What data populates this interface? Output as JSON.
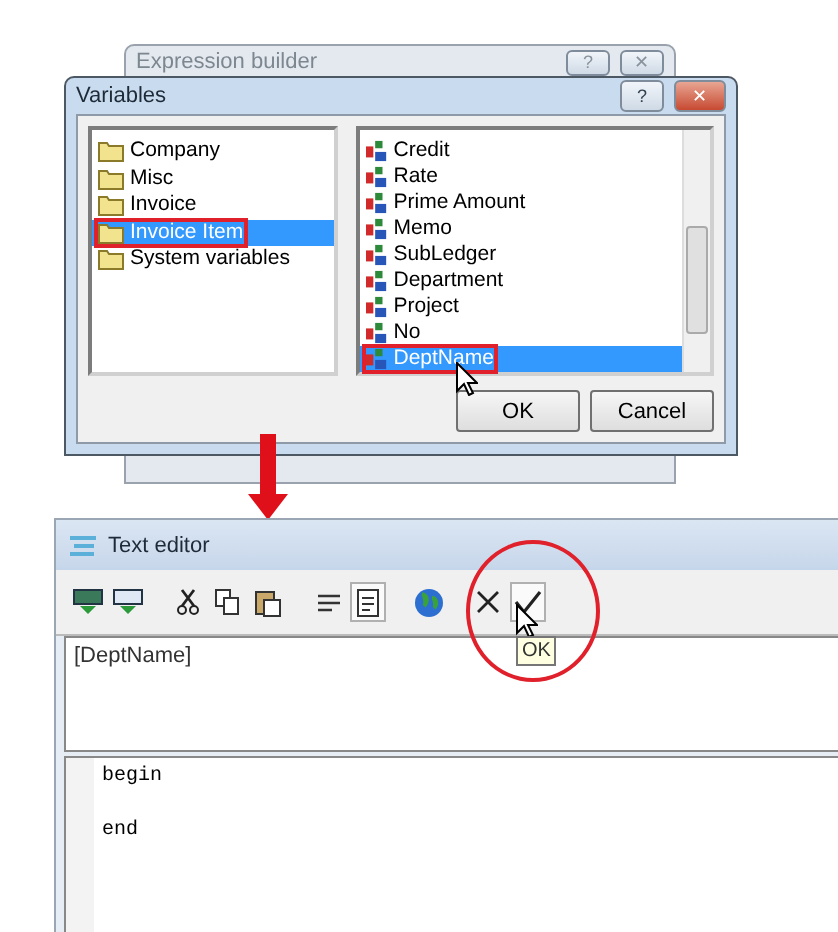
{
  "expression_builder": {
    "title": "Expression builder",
    "title_buttons": [
      "?",
      "✕"
    ]
  },
  "variables_dialog": {
    "title": "Variables",
    "title_buttons": [
      "?",
      "✕"
    ],
    "categories": [
      {
        "label": "Company",
        "selected": false
      },
      {
        "label": "Misc",
        "selected": false
      },
      {
        "label": "Invoice",
        "selected": false
      },
      {
        "label": "Invoice Item",
        "selected": true
      },
      {
        "label": "System variables",
        "selected": false
      }
    ],
    "fields": [
      {
        "label": "Credit",
        "selected": false
      },
      {
        "label": "Rate",
        "selected": false
      },
      {
        "label": "Prime Amount",
        "selected": false
      },
      {
        "label": "Memo",
        "selected": false
      },
      {
        "label": "SubLedger",
        "selected": false
      },
      {
        "label": "Department",
        "selected": false
      },
      {
        "label": "Project",
        "selected": false
      },
      {
        "label": "No",
        "selected": false
      },
      {
        "label": "DeptName",
        "selected": true
      }
    ],
    "buttons": [
      "OK",
      "Cancel"
    ]
  },
  "text_editor": {
    "title": "Text editor",
    "toolbar": [
      {
        "kind": "insert",
        "pressed": false
      },
      {
        "kind": "form",
        "pressed": false
      },
      {
        "kind": "sep"
      },
      {
        "kind": "cut",
        "pressed": false
      },
      {
        "kind": "copy",
        "pressed": false
      },
      {
        "kind": "paste",
        "pressed": false
      },
      {
        "kind": "sep"
      },
      {
        "kind": "align",
        "pressed": false
      },
      {
        "kind": "page",
        "pressed": true
      },
      {
        "kind": "sep"
      },
      {
        "kind": "globe",
        "pressed": false
      },
      {
        "kind": "sep"
      },
      {
        "kind": "cancel",
        "pressed": false
      },
      {
        "kind": "ok",
        "pressed": true
      }
    ],
    "expression": "[DeptName]",
    "code_lines": [
      "begin",
      "end"
    ],
    "tooltip": "OK"
  }
}
